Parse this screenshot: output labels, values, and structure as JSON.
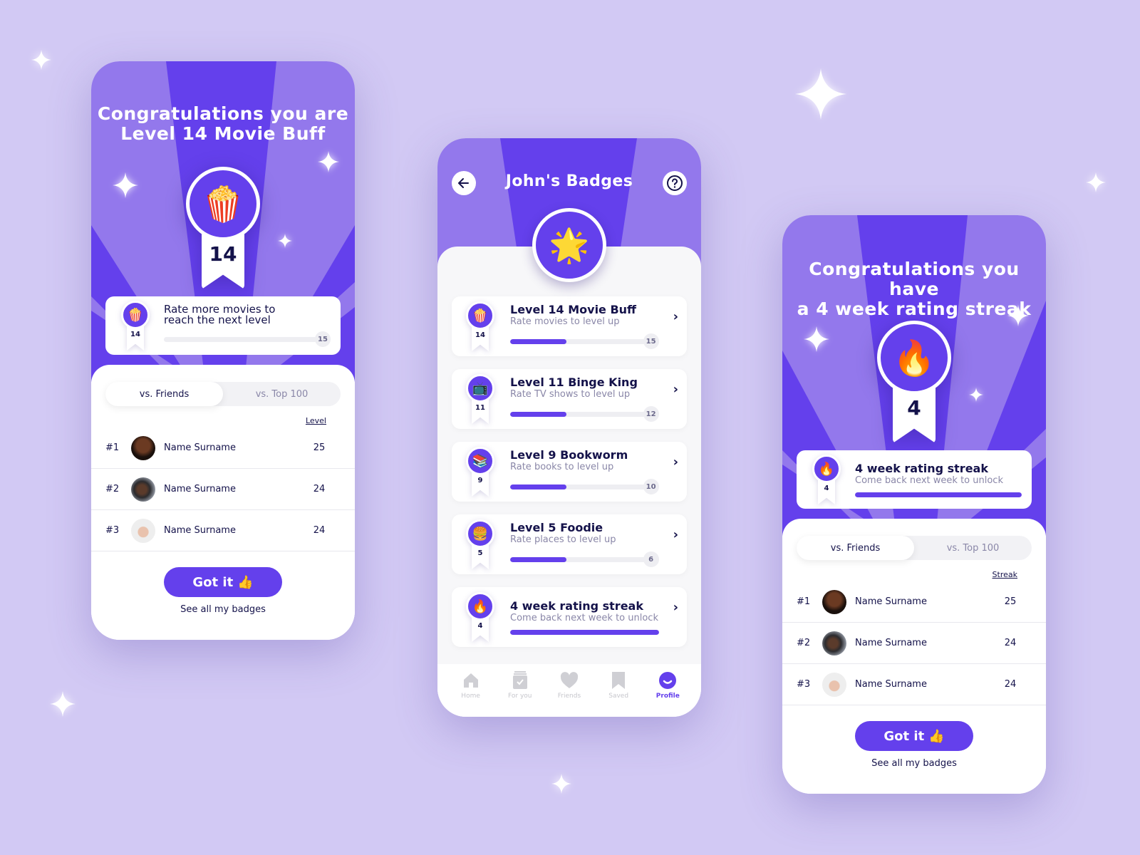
{
  "colors": {
    "background": "#d2c9f4",
    "primary": "#6440ec",
    "hero_light": "#9378ec",
    "text_dark": "#14124a",
    "text_muted": "#8a87a8"
  },
  "screen_level": {
    "title_line1": "Congratulations you are",
    "title_line2": "Level 14 Movie Buff",
    "badge_icon": "🍿",
    "badge_icon_name": "popcorn-icon",
    "badge_level": "14",
    "card": {
      "icon": "🍿",
      "level": "14",
      "text_line1": "Rate more movies to",
      "text_line2": "reach the next level",
      "next_level": "15",
      "progress_percent": 0
    },
    "tabs": [
      {
        "label": "vs. Friends",
        "active": true
      },
      {
        "label": "vs. Top 100",
        "active": false
      }
    ],
    "column_header": "Level",
    "leaderboard": [
      {
        "rank": "#1",
        "name": "Name Surname",
        "value": "25"
      },
      {
        "rank": "#2",
        "name": "Name Surname",
        "value": "24"
      },
      {
        "rank": "#3",
        "name": "Name Surname",
        "value": "24"
      }
    ],
    "got_it_label": "Got it",
    "got_it_emoji": "👍",
    "see_all_label": "See all my badges"
  },
  "screen_badges": {
    "title": "John's Badges",
    "back_icon": "arrow-left-icon",
    "help_icon": "question-circle-icon",
    "header_icon": "🌟",
    "badges": [
      {
        "icon": "🍿",
        "level": "14",
        "title": "Level 14 Movie Buff",
        "subtitle": "Rate movies to level up",
        "next": "15",
        "progress_percent": 40
      },
      {
        "icon": "📺",
        "level": "11",
        "title": "Level 11 Binge King",
        "subtitle": "Rate TV shows to level up",
        "next": "12",
        "progress_percent": 40
      },
      {
        "icon": "📚",
        "level": "9",
        "title": "Level 9 Bookworm",
        "subtitle": "Rate books to level up",
        "next": "10",
        "progress_percent": 40
      },
      {
        "icon": "🍔",
        "level": "5",
        "title": "Level 5 Foodie",
        "subtitle": "Rate places to level up",
        "next": "6",
        "progress_percent": 40
      },
      {
        "icon": "🔥",
        "level": "4",
        "title": "4 week rating streak",
        "subtitle": "Come back next week to unlock",
        "next": "",
        "progress_percent": 100
      }
    ],
    "tabbar": [
      {
        "label": "Home",
        "icon": "home-icon",
        "active": false
      },
      {
        "label": "For you",
        "icon": "for-you-icon",
        "active": false
      },
      {
        "label": "Friends",
        "icon": "heart-icon",
        "active": false
      },
      {
        "label": "Saved",
        "icon": "bookmark-icon",
        "active": false
      },
      {
        "label": "Profile",
        "icon": "profile-icon",
        "active": true
      }
    ]
  },
  "screen_streak": {
    "title_line1": "Congratulations you have",
    "title_line2": "a 4 week rating streak",
    "badge_icon": "🔥",
    "badge_level": "4",
    "card": {
      "icon": "🔥",
      "level": "4",
      "title": "4 week rating streak",
      "subtitle": "Come back next week to unlock",
      "progress_percent": 100
    },
    "tabs": [
      {
        "label": "vs. Friends",
        "active": true
      },
      {
        "label": "vs. Top 100",
        "active": false
      }
    ],
    "column_header": "Streak",
    "leaderboard": [
      {
        "rank": "#1",
        "name": "Name Surname",
        "value": "25"
      },
      {
        "rank": "#2",
        "name": "Name Surname",
        "value": "24"
      },
      {
        "rank": "#3",
        "name": "Name Surname",
        "value": "24"
      }
    ],
    "got_it_label": "Got it",
    "got_it_emoji": "👍",
    "see_all_label": "See all my badges"
  }
}
